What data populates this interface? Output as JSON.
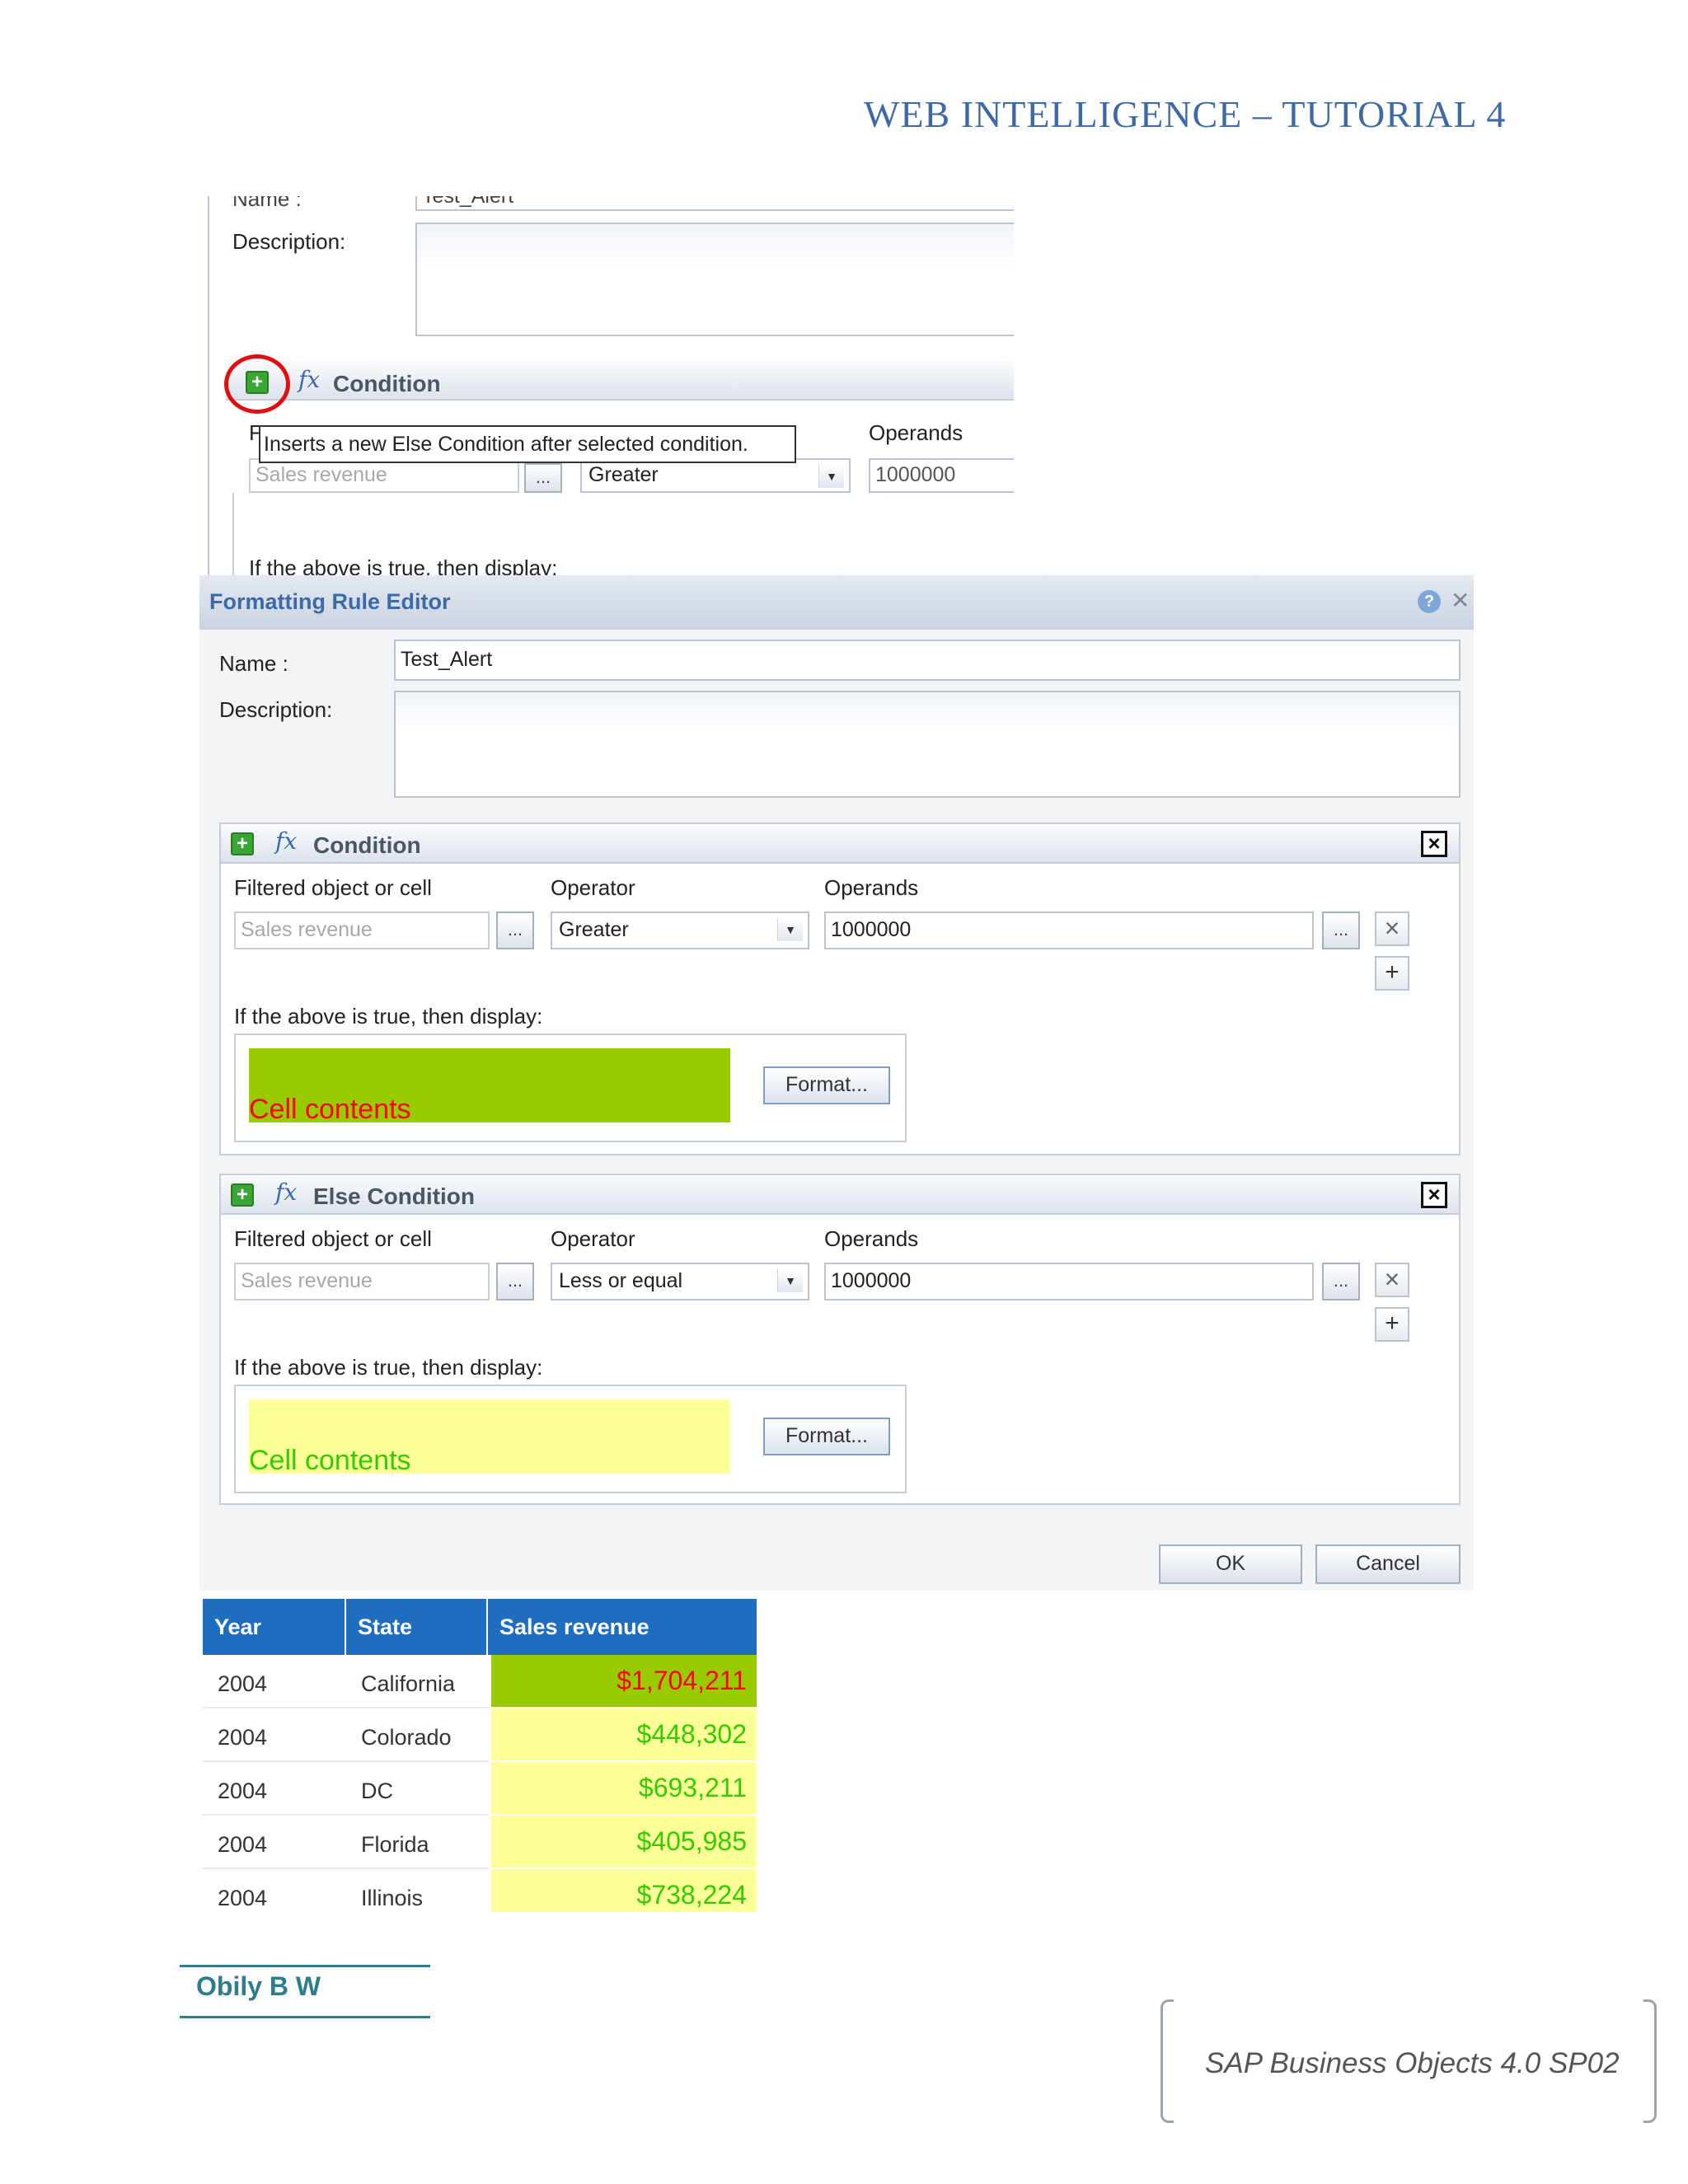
{
  "header": {
    "title": "WEB INTELLIGENCE – TUTORIAL 4"
  },
  "top_dialog": {
    "name_label": "Name :",
    "name_value": "Test_Alert",
    "description_label": "Description:",
    "condition_title": "Condition",
    "filtered_label": "F",
    "tooltip": "Inserts a new Else Condition after selected condition.",
    "operands_label": "Operands",
    "filtered_value": "Sales revenue",
    "dots": "...",
    "operator_value": "Greater",
    "operand_value": "1000000",
    "then_display": "If the above is true, then display:"
  },
  "editor": {
    "title": "Formatting Rule Editor",
    "help_icon": "?",
    "close_icon": "✕",
    "name_label": "Name :",
    "name_value": "Test_Alert",
    "description_label": "Description:",
    "condition": {
      "title": "Condition",
      "filtered_label": "Filtered object or cell",
      "operator_label": "Operator",
      "operands_label": "Operands",
      "filtered_value": "Sales revenue",
      "dots": "...",
      "operator_value": "Greater",
      "operand_value": "1000000",
      "then_display": "If the above is true, then display:",
      "preview_text": "Cell contents",
      "format_button": "Format...",
      "preview_bg": "#99cc00",
      "preview_fg": "#ff0000"
    },
    "else_condition": {
      "title": "Else Condition",
      "filtered_label": "Filtered object or cell",
      "operator_label": "Operator",
      "operands_label": "Operands",
      "filtered_value": "Sales revenue",
      "dots": "...",
      "operator_value": "Less or equal",
      "operand_value": "1000000",
      "then_display": "If the above is true, then display:",
      "preview_text": "Cell contents",
      "format_button": "Format...",
      "preview_bg": "#ffff99",
      "preview_fg": "#33cc00"
    },
    "ok_button": "OK",
    "cancel_button": "Cancel"
  },
  "table": {
    "headers": [
      "Year",
      "State",
      "Sales revenue"
    ],
    "rows": [
      {
        "year": "2004",
        "state": "California",
        "revenue": "$1,704,211",
        "bg": "#99cc00",
        "fg": "#ff0000"
      },
      {
        "year": "2004",
        "state": "Colorado",
        "revenue": "$448,302",
        "bg": "#ffff99",
        "fg": "#33cc00"
      },
      {
        "year": "2004",
        "state": "DC",
        "revenue": "$693,211",
        "bg": "#ffff99",
        "fg": "#33cc00"
      },
      {
        "year": "2004",
        "state": "Florida",
        "revenue": "$405,985",
        "bg": "#ffff99",
        "fg": "#33cc00"
      },
      {
        "year": "2004",
        "state": "Illinois",
        "revenue": "$738,224",
        "bg": "#ffff99",
        "fg": "#33cc00"
      }
    ]
  },
  "footer": {
    "author": "Obily B W",
    "product": "SAP Business Objects 4.0 SP02"
  },
  "colors": {
    "accent": "#3d6aa6",
    "table_header": "#1f6dbf",
    "footer_teal": "#2e7d8c"
  }
}
